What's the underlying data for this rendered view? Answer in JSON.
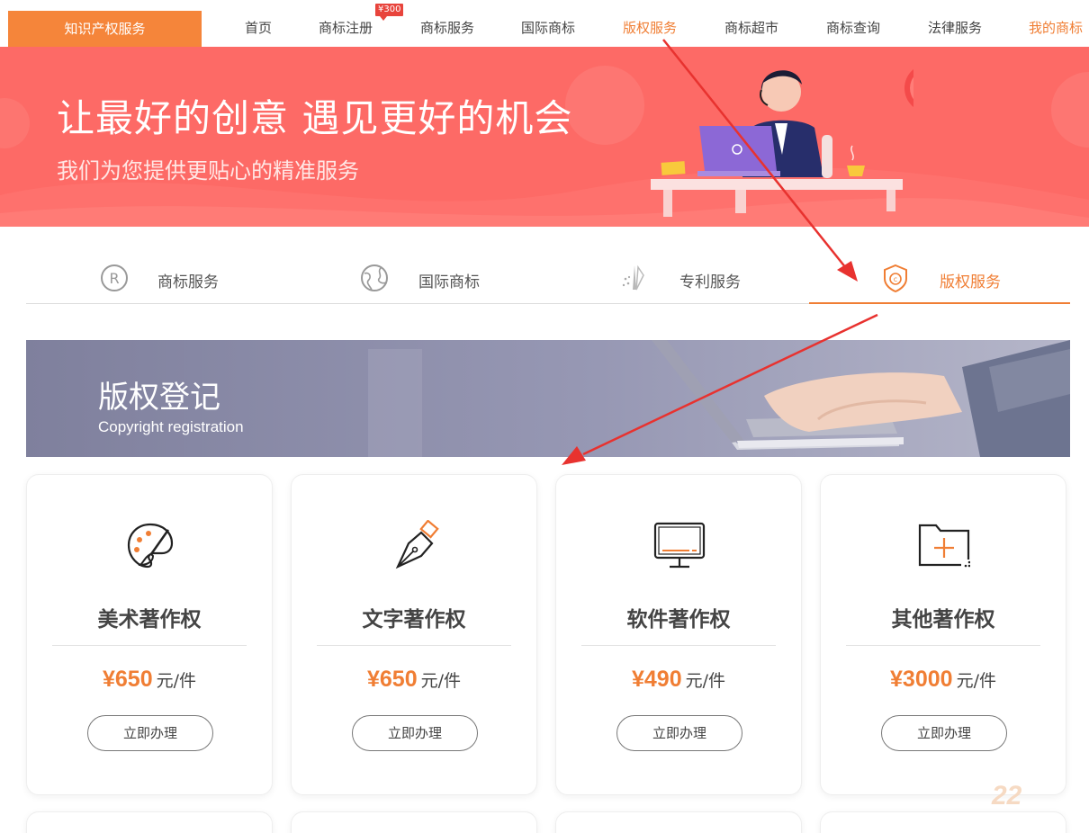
{
  "nav": {
    "category": "知识产权服务",
    "links": [
      "首页",
      "商标注册",
      "商标服务",
      "国际商标",
      "版权服务",
      "商标超市",
      "商标查询",
      "法律服务",
      "我的商标"
    ],
    "badge": "¥300",
    "active": "版权服务"
  },
  "hero": {
    "title": "让最好的创意  遇见更好的机会",
    "subtitle": "我们为您提供更贴心的精准服务"
  },
  "tabs": [
    {
      "label": "商标服务",
      "icon": "registered-icon"
    },
    {
      "label": "国际商标",
      "icon": "globe-icon"
    },
    {
      "label": "专利服务",
      "icon": "patent-icon"
    },
    {
      "label": "版权服务",
      "icon": "copyright-shield-icon"
    }
  ],
  "section": {
    "title": "版权登记",
    "subtitle": "Copyright registration"
  },
  "cards": [
    {
      "name": "美术著作权",
      "price": "¥650",
      "unit": "元/件",
      "button": "立即办理",
      "icon": "palette-icon"
    },
    {
      "name": "文字著作权",
      "price": "¥650",
      "unit": "元/件",
      "button": "立即办理",
      "icon": "pen-nib-icon"
    },
    {
      "name": "软件著作权",
      "price": "¥490",
      "unit": "元/件",
      "button": "立即办理",
      "icon": "monitor-icon"
    },
    {
      "name": "其他著作权",
      "price": "¥3000",
      "unit": "元/件",
      "button": "立即办理",
      "icon": "folder-plus-icon"
    }
  ],
  "watermark": "22",
  "colors": {
    "accent": "#f07e34",
    "hero": "#fd6a66",
    "arrow": "#e8322f"
  }
}
